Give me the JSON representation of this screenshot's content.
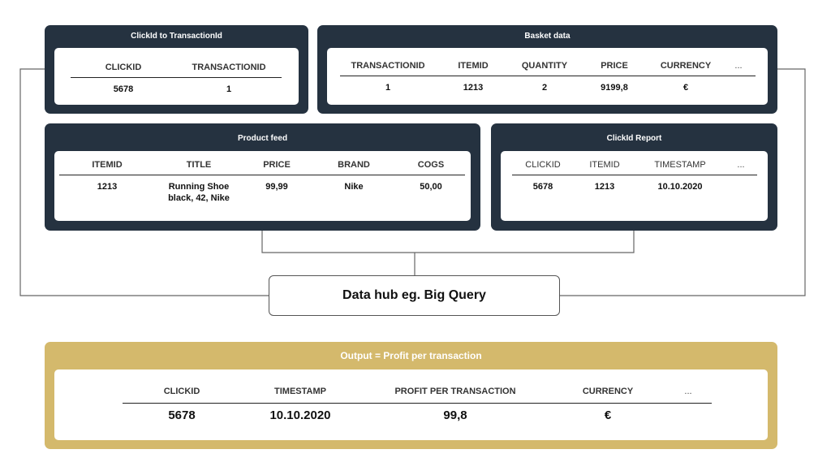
{
  "panels": {
    "clickid_to_transaction": {
      "title": "ClickId to TransactionId",
      "headers": [
        "CLICKID",
        "TRANSACTIONID"
      ],
      "row": [
        "5678",
        "1"
      ]
    },
    "basket_data": {
      "title": "Basket data",
      "headers": [
        "TRANSACTIONID",
        "ITEMID",
        "QUANTITY",
        "PRICE",
        "CURRENCY",
        "..."
      ],
      "row": [
        "1",
        "1213",
        "2",
        "9199,8",
        "€",
        ""
      ]
    },
    "product_feed": {
      "title": "Product feed",
      "headers": [
        "ITEMID",
        "TITLE",
        "PRICE",
        "BRAND",
        "COGS"
      ],
      "row": [
        "1213",
        "Running Shoe black, 42, Nike",
        "99,99",
        "Nike",
        "50,00"
      ]
    },
    "clickid_report": {
      "title": "ClickId Report",
      "headers": [
        "CLICKID",
        "ITEMID",
        "TIMESTAMP",
        "..."
      ],
      "row": [
        "5678",
        "1213",
        "10.10.2020",
        ""
      ]
    }
  },
  "hub": {
    "label": "Data hub eg. Big Query"
  },
  "output": {
    "title": "Output = Profit per transaction",
    "headers": [
      "CLICKID",
      "TIMESTAMP",
      "PROFIT PER TRANSACTION",
      "CURRENCY",
      "..."
    ],
    "row": [
      "5678",
      "10.10.2020",
      "99,8",
      "€",
      ""
    ]
  },
  "colors": {
    "panel_dark": "#253240",
    "output_gold": "#d4b96c",
    "line": "#666666"
  }
}
